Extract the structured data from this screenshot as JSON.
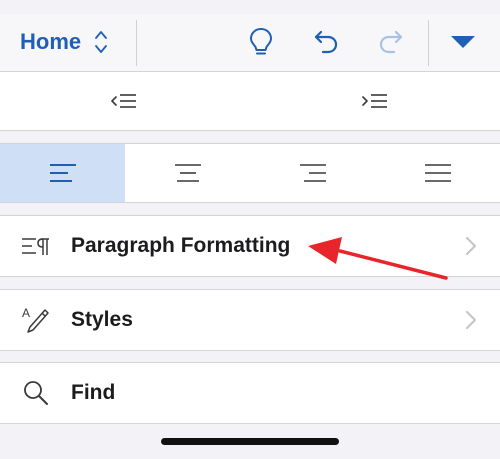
{
  "toolbar": {
    "tab_label": "Home"
  },
  "menu": {
    "items": [
      {
        "label": "Paragraph Formatting"
      },
      {
        "label": "Styles"
      },
      {
        "label": "Find"
      }
    ]
  },
  "colors": {
    "accent": "#1f5fb4",
    "selected_bg": "#cfe0f6",
    "annotation": "#e8252a"
  }
}
